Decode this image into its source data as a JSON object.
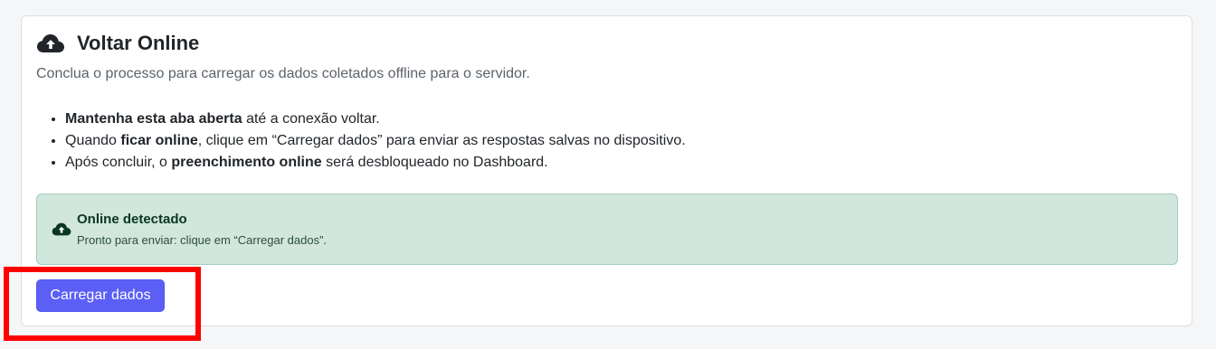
{
  "card": {
    "title": "Voltar Online",
    "title_icon": "cloud-upload-icon",
    "subtitle": "Conclua o processo para carregar os dados coletados offline para o servidor.",
    "bullets": [
      {
        "bold": "Mantenha esta aba aberta",
        "after": " até a conexão voltar."
      },
      {
        "before": "Quando ",
        "bold": "ficar online",
        "after": ", clique em “Carregar dados” para enviar as respostas salvas no dispositivo."
      },
      {
        "before": "Após concluir, o ",
        "bold": "preenchimento online",
        "after": " será desbloqueado no Dashboard."
      }
    ]
  },
  "alert": {
    "icon": "cloud-upload-icon",
    "title": "Online detectado",
    "text": "Pronto para enviar: clique em “Carregar dados”."
  },
  "actions": {
    "upload_label": "Carregar dados"
  },
  "colors": {
    "button": "#5b5ff5",
    "alert_bg": "#d1e7dd",
    "highlight": "#ff0000"
  }
}
